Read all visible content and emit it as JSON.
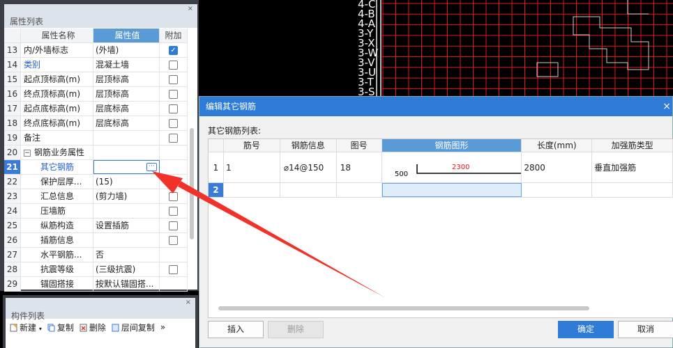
{
  "cad": {
    "axis_labels": [
      "4-C",
      "4-B",
      "4-A",
      "3-Y",
      "3-X",
      "3-W",
      "3-V",
      "3-U",
      "3-T",
      "3-S"
    ]
  },
  "props": {
    "title": "属性列表",
    "close": "×",
    "headers": {
      "name": "属性名称",
      "value": "属性值",
      "extra": "附加"
    },
    "rows": [
      {
        "no": "13",
        "name": "内/外墙标志",
        "value": "(外墙)",
        "check": "on"
      },
      {
        "no": "14",
        "name": "类别",
        "value": "混凝土墙",
        "check": "off",
        "blue": true
      },
      {
        "no": "15",
        "name": "起点顶标高(m)",
        "value": "层顶标高",
        "check": "off"
      },
      {
        "no": "16",
        "name": "终点顶标高(m)",
        "value": "层顶标高",
        "check": "off"
      },
      {
        "no": "17",
        "name": "起点底标高(m)",
        "value": "层底标高",
        "check": "off"
      },
      {
        "no": "18",
        "name": "终点底标高(m)",
        "value": "层底标高",
        "check": "off"
      },
      {
        "no": "19",
        "name": "备注",
        "value": "",
        "check": "off"
      },
      {
        "no": "20",
        "name": "钢筋业务属性",
        "value": "",
        "check": "none",
        "group": true
      },
      {
        "no": "21",
        "name": "其它钢筋",
        "value": "",
        "check": "none",
        "sub": true,
        "blue": true,
        "selected": true
      },
      {
        "no": "22",
        "name": "保护层厚...",
        "value": "(15)",
        "check": "off",
        "sub": true
      },
      {
        "no": "23",
        "name": "汇总信息",
        "value": "(剪力墙)",
        "check": "off",
        "sub": true
      },
      {
        "no": "24",
        "name": "压墙筋",
        "value": "",
        "check": "off",
        "sub": true
      },
      {
        "no": "25",
        "name": "纵筋构造",
        "value": "设置插筋",
        "check": "off",
        "sub": true
      },
      {
        "no": "26",
        "name": "插筋信息",
        "value": "",
        "check": "off",
        "sub": true
      },
      {
        "no": "27",
        "name": "水平钢筋...",
        "value": "否",
        "check": "none",
        "sub": true
      },
      {
        "no": "28",
        "name": "抗震等级",
        "value": "(三级抗震)",
        "check": "off",
        "sub": true
      },
      {
        "no": "29",
        "name": "锚固搭接",
        "value": "按默认锚固搭...",
        "check": "none",
        "sub": true
      }
    ]
  },
  "components": {
    "title": "构件列表",
    "close": "×",
    "tools": {
      "new": "新建",
      "copy": "复制",
      "delete": "删除",
      "floor_copy": "层间复制",
      "more": "»"
    }
  },
  "dialog": {
    "title": "编辑其它钢筋",
    "close": "×",
    "list_label": "其它钢筋列表:",
    "headers": [
      "",
      "筋号",
      "钢筋信息",
      "图号",
      "钢筋图形",
      "长度(mm)",
      "加强筋类型"
    ],
    "rows": [
      {
        "no": "1",
        "bar_no": "1",
        "info": "⌀14@150",
        "fig": "18",
        "shape_left": "500",
        "shape_top": "2300",
        "length": "2800",
        "type": "垂直加强筋"
      },
      {
        "no": "2",
        "bar_no": "",
        "info": "",
        "fig": "",
        "shape_left": "",
        "shape_top": "",
        "length": "",
        "type": ""
      }
    ],
    "buttons": {
      "insert": "插入",
      "delete": "删除",
      "ok": "确定",
      "cancel": "取消"
    }
  },
  "colors": {
    "accent": "#2e7bd8",
    "grid_red": "#e8141b",
    "arrow": "#f0322a"
  }
}
